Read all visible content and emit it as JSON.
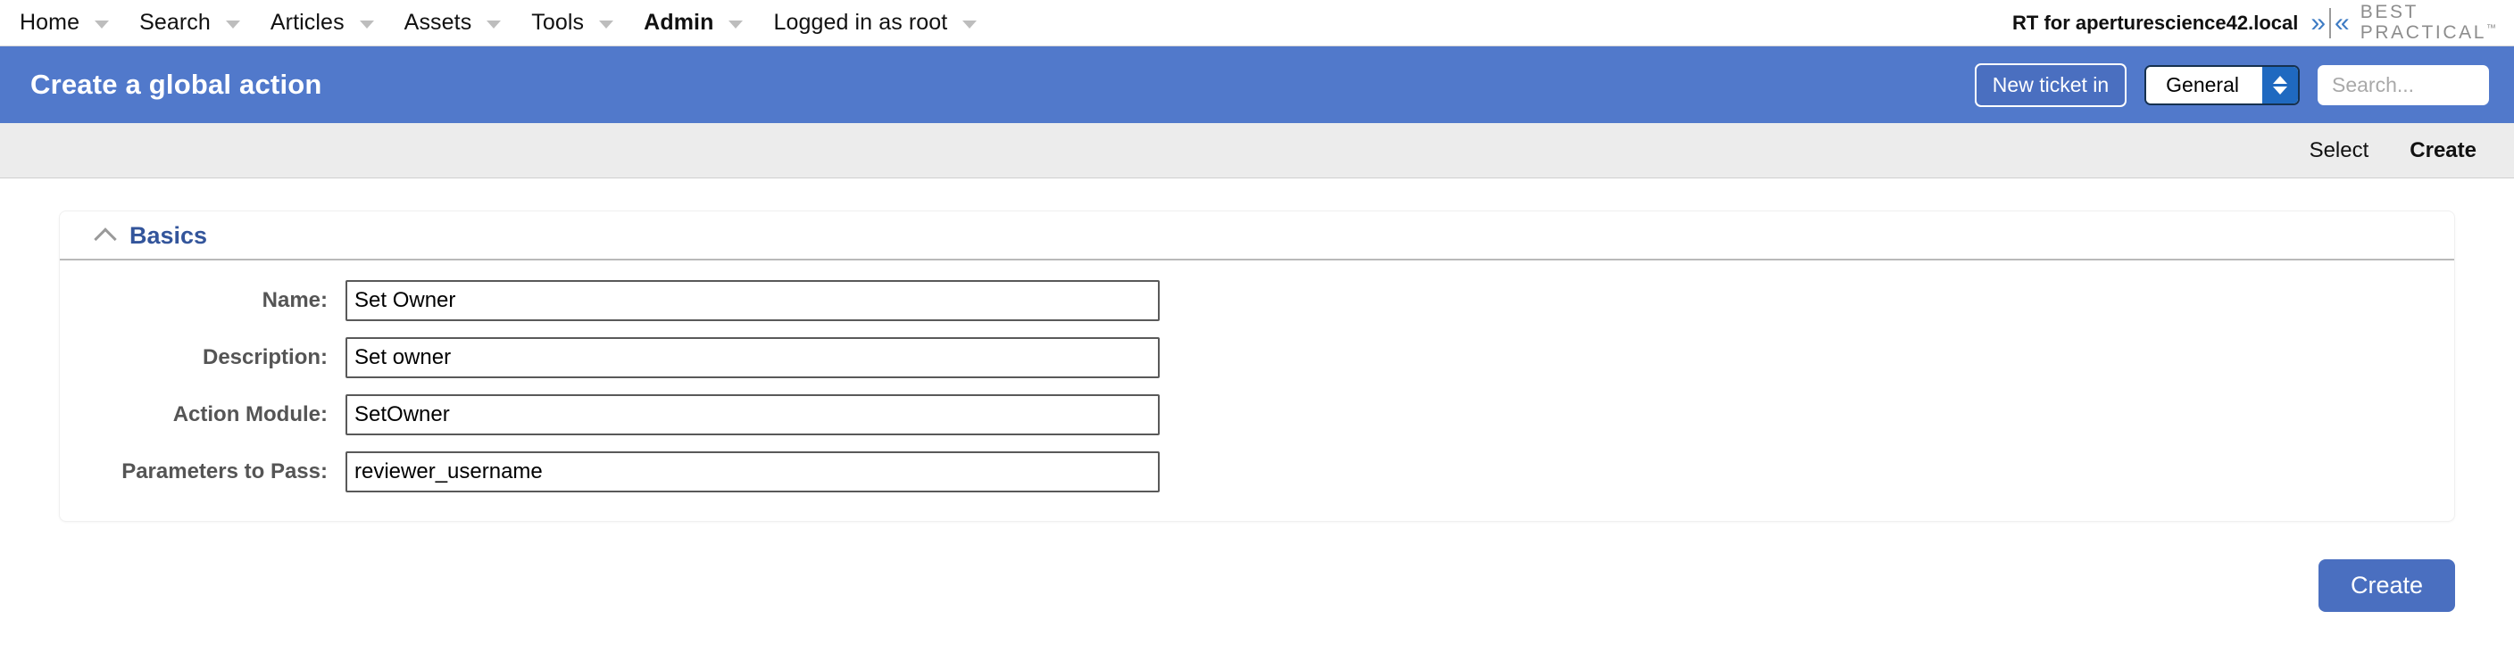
{
  "topnav": {
    "items": [
      {
        "label": "Home",
        "active": false,
        "has_caret": true
      },
      {
        "label": "Search",
        "active": false,
        "has_caret": true
      },
      {
        "label": "Articles",
        "active": false,
        "has_caret": true
      },
      {
        "label": "Assets",
        "active": false,
        "has_caret": true
      },
      {
        "label": "Tools",
        "active": false,
        "has_caret": true
      },
      {
        "label": "Admin",
        "active": true,
        "has_caret": true
      },
      {
        "label": "Logged in as root",
        "active": false,
        "has_caret": true
      }
    ],
    "instance_label": "RT for aperturescience42.local",
    "chevron_right": "»",
    "chevron_left": "«",
    "brand_line1": "BEST",
    "brand_line2": "PRACTICAL",
    "brand_tm": "™"
  },
  "pagehead": {
    "title": "Create a global action",
    "new_ticket_label": "New ticket in",
    "queue_selected": "General",
    "search_placeholder": "Search...",
    "search_value": "",
    "background_color": "#5179cb"
  },
  "subtoolbar": {
    "links": [
      {
        "label": "Select",
        "active": false
      },
      {
        "label": "Create",
        "active": true
      }
    ]
  },
  "basics": {
    "section_title": "Basics",
    "fields": [
      {
        "label": "Name:",
        "value": "Set Owner",
        "name": "name"
      },
      {
        "label": "Description:",
        "value": "Set owner",
        "name": "description"
      },
      {
        "label": "Action Module:",
        "value": "SetOwner",
        "name": "action-module"
      },
      {
        "label": "Parameters to Pass:",
        "value": "reviewer_username",
        "name": "parameters-to-pass"
      }
    ]
  },
  "footer": {
    "create_label": "Create",
    "accent_color": "#4a6fc0"
  }
}
